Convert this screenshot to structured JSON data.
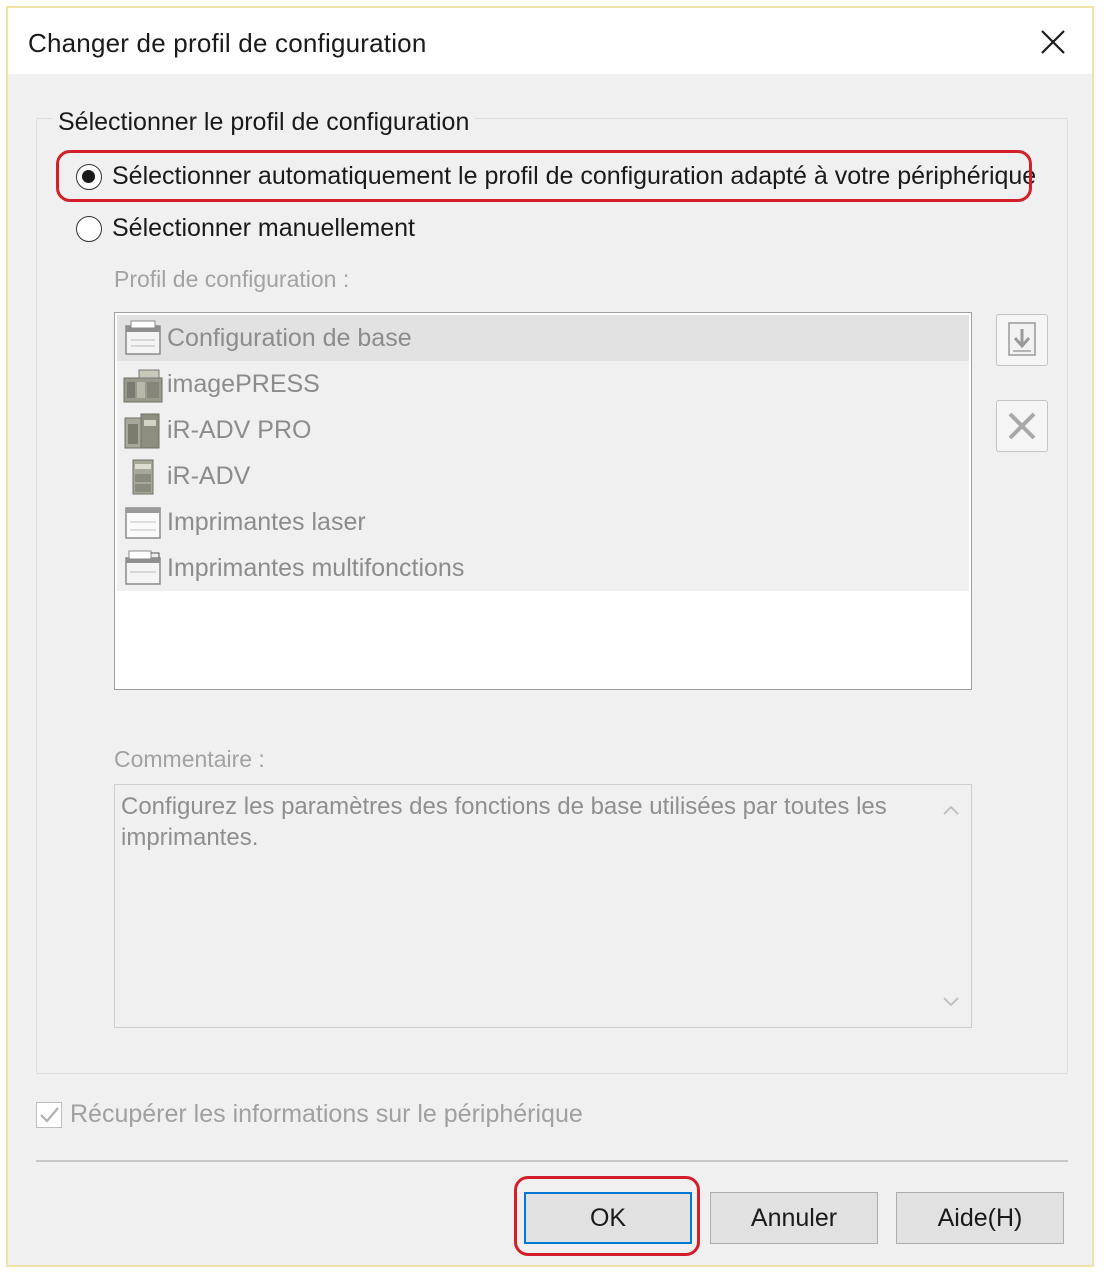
{
  "dialog": {
    "title": "Changer de profil de configuration",
    "close_icon": "close-icon"
  },
  "group": {
    "legend": "Sélectionner le profil de configuration"
  },
  "radios": {
    "auto_label": "Sélectionner automatiquement le profil de configuration adapté à votre périphérique",
    "auto_checked": true,
    "manual_label": "Sélectionner manuellement",
    "manual_checked": false
  },
  "profiles": {
    "label": "Profil de configuration :",
    "items": [
      {
        "label": "Configuration de base",
        "icon": "base-config-icon",
        "selected": true
      },
      {
        "label": "imagePRESS",
        "icon": "imagepress-printer-icon",
        "selected": false
      },
      {
        "label": "iR-ADV PRO",
        "icon": "ir-adv-pro-printer-icon",
        "selected": false
      },
      {
        "label": "iR-ADV",
        "icon": "ir-adv-printer-icon",
        "selected": false
      },
      {
        "label": "Imprimantes laser",
        "icon": "laser-printer-icon",
        "selected": false
      },
      {
        "label": "Imprimantes multifonctions",
        "icon": "multifunction-printer-icon",
        "selected": false
      }
    ],
    "import_icon": "import-icon",
    "delete_icon": "delete-icon"
  },
  "comment": {
    "label": "Commentaire :",
    "text": "Configurez les paramètres des fonctions de base utilisées par toutes les imprimantes."
  },
  "retrieve": {
    "label": "Récupérer les informations sur le périphérique",
    "checked": true
  },
  "buttons": {
    "ok": "OK",
    "cancel": "Annuler",
    "help": "Aide(H)"
  },
  "colors": {
    "highlight": "#d41f2a",
    "focus": "#0078d7"
  }
}
